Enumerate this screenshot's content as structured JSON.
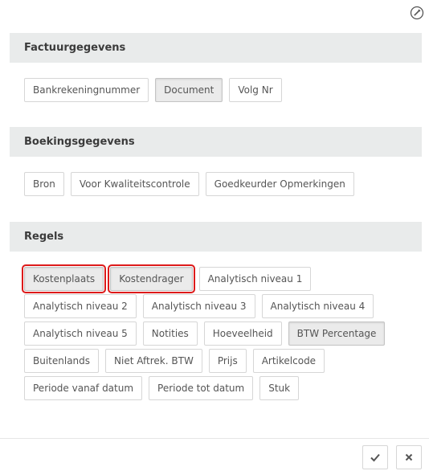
{
  "top_icon": "edit-circle-icon",
  "sections": {
    "factuur": {
      "title": "Factuurgegevens",
      "buttons": [
        {
          "label": "Bankrekeningnummer"
        },
        {
          "label": "Document",
          "active": true
        },
        {
          "label": "Volg Nr"
        }
      ]
    },
    "boeking": {
      "title": "Boekingsgegevens",
      "buttons": [
        {
          "label": "Bron"
        },
        {
          "label": "Voor Kwaliteitscontrole"
        },
        {
          "label": "Goedkeurder Opmerkingen"
        }
      ]
    },
    "regels": {
      "title": "Regels",
      "buttons": [
        {
          "label": "Kostenplaats",
          "active": true,
          "highlighted": true
        },
        {
          "label": "Kostendrager",
          "active": true,
          "highlighted": true
        },
        {
          "label": "Analytisch niveau 1"
        },
        {
          "label": "Analytisch niveau 2"
        },
        {
          "label": "Analytisch niveau 3"
        },
        {
          "label": "Analytisch niveau 4"
        },
        {
          "label": "Analytisch niveau 5"
        },
        {
          "label": "Notities"
        },
        {
          "label": "Hoeveelheid"
        },
        {
          "label": "BTW Percentage",
          "active": true
        },
        {
          "label": "Buitenlands"
        },
        {
          "label": "Niet Aftrek. BTW"
        },
        {
          "label": "Prijs"
        },
        {
          "label": "Artikelcode"
        },
        {
          "label": "Periode vanaf datum"
        },
        {
          "label": "Periode tot datum"
        },
        {
          "label": "Stuk"
        }
      ]
    }
  },
  "footer": {
    "confirm_icon": "checkmark-icon",
    "cancel_icon": "close-icon"
  },
  "colors": {
    "header_bg": "#e9ebeb",
    "highlight": "#dd1a1a",
    "active_bg": "#ebebeb"
  }
}
